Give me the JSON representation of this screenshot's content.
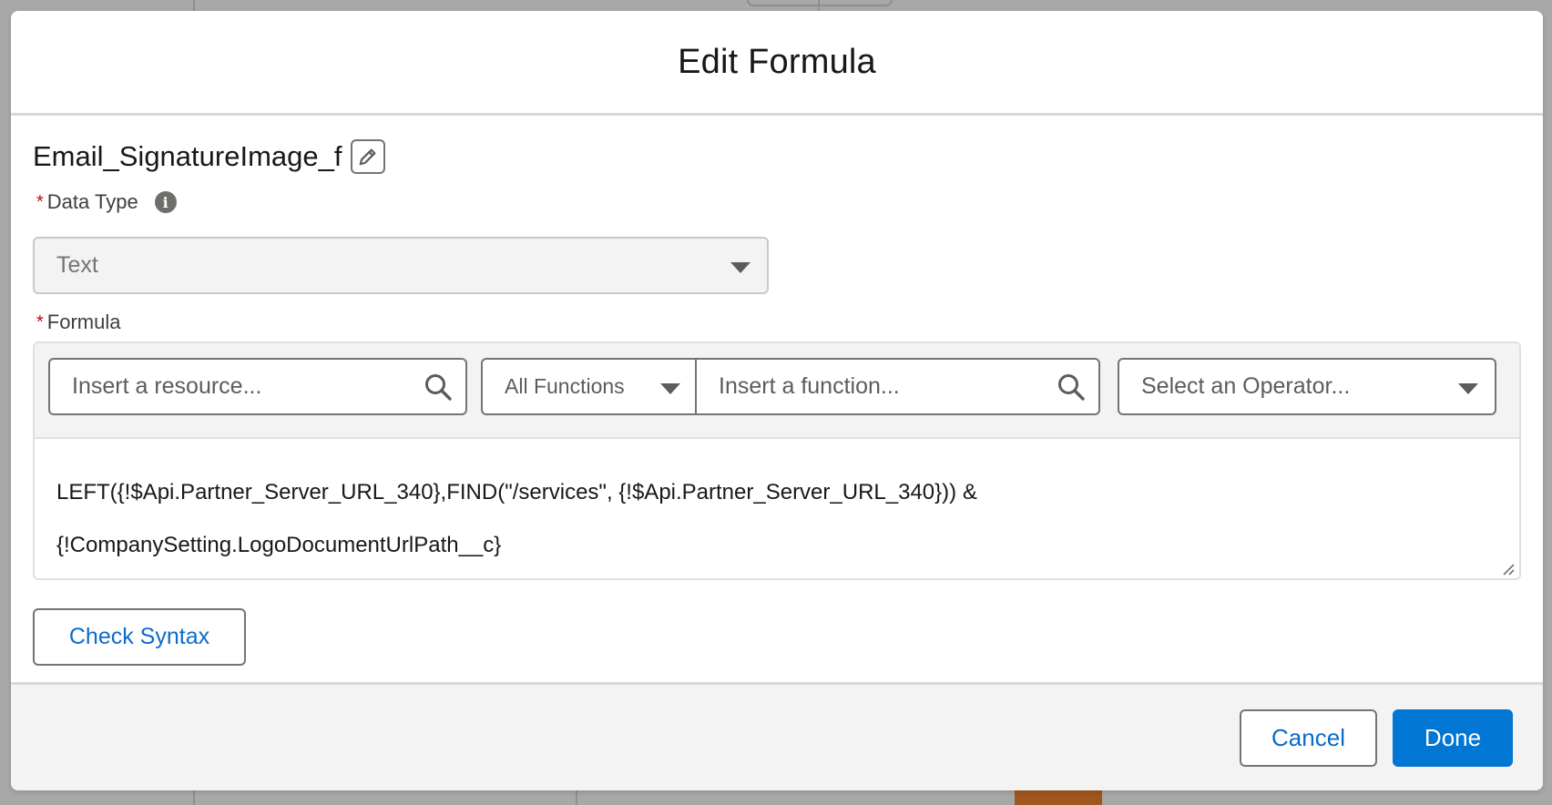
{
  "modal": {
    "title": "Edit Formula"
  },
  "resource": {
    "api_name": "Email_SignatureImage_f",
    "edit_icon": "pencil-icon"
  },
  "data_type": {
    "label": "Data Type",
    "required_marker": "*",
    "info_icon": "info-icon",
    "value": "Text"
  },
  "formula": {
    "label": "Formula",
    "required_marker": "*",
    "toolbar": {
      "resource_placeholder": "Insert a resource...",
      "functions_filter": "All Functions",
      "function_placeholder": "Insert a function...",
      "operator_placeholder": "Select an Operator..."
    },
    "lines": [
      "LEFT({!$Api.Partner_Server_URL_340},FIND(\"/services\", {!$Api.Partner_Server_URL_340})) &",
      "{!CompanySetting.LogoDocumentUrlPath__c}"
    ]
  },
  "actions": {
    "check_syntax": "Check Syntax",
    "cancel": "Cancel",
    "done": "Done"
  },
  "colors": {
    "brand": "#0176d3",
    "link": "#0b6bcb",
    "required": "#ba0517"
  }
}
